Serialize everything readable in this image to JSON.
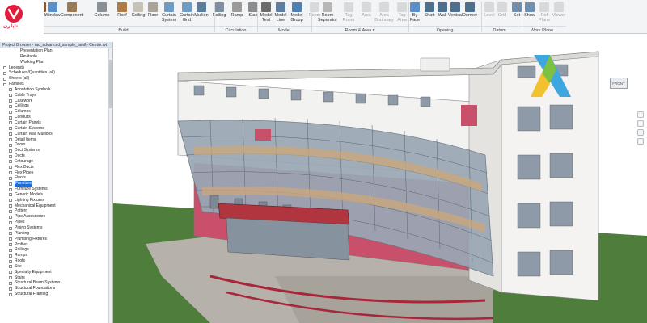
{
  "logo": {
    "text": "ﺗﺎﭘﻠﺮﻥ"
  },
  "ribbon": {
    "tools": [
      {
        "id": "door",
        "label": "Door",
        "enabled": true
      },
      {
        "id": "window",
        "label": "Window",
        "enabled": true
      },
      {
        "id": "component",
        "label": "Component",
        "enabled": true
      },
      {
        "id": "column",
        "label": "Column",
        "enabled": true
      },
      {
        "id": "roof",
        "label": "Roof",
        "enabled": true
      },
      {
        "id": "ceiling",
        "label": "Ceiling",
        "enabled": true
      },
      {
        "id": "floor",
        "label": "Floor",
        "enabled": true
      },
      {
        "id": "curtain-system",
        "label": "Curtain\nSystem",
        "enabled": true
      },
      {
        "id": "curtain-grid",
        "label": "Curtain\nGrid",
        "enabled": true
      },
      {
        "id": "mullion",
        "label": "Mullion",
        "enabled": true
      },
      {
        "id": "railing",
        "label": "Railing",
        "enabled": true
      },
      {
        "id": "ramp",
        "label": "Ramp",
        "enabled": true
      },
      {
        "id": "stair",
        "label": "Stair",
        "enabled": true
      },
      {
        "id": "model-text",
        "label": "Model\nText",
        "enabled": true
      },
      {
        "id": "model-line",
        "label": "Model\nLine",
        "enabled": true
      },
      {
        "id": "model-group",
        "label": "Model\nGroup",
        "enabled": true
      },
      {
        "id": "room",
        "label": "Room",
        "enabled": false
      },
      {
        "id": "room-separator",
        "label": "Room\nSeparator",
        "enabled": true
      },
      {
        "id": "tag-room",
        "label": "Tag\nRoom",
        "enabled": false
      },
      {
        "id": "area",
        "label": "Area",
        "enabled": false
      },
      {
        "id": "area-boundary",
        "label": "Area\nBoundary",
        "enabled": false
      },
      {
        "id": "tag-area",
        "label": "Tag\nArea",
        "enabled": false
      },
      {
        "id": "by-face",
        "label": "By\nFace",
        "enabled": true
      },
      {
        "id": "shaft",
        "label": "Shaft",
        "enabled": true
      },
      {
        "id": "wall",
        "label": "Wall",
        "enabled": true
      },
      {
        "id": "vertical",
        "label": "Vertical",
        "enabled": true
      },
      {
        "id": "dormer",
        "label": "Dormer",
        "enabled": true
      },
      {
        "id": "level",
        "label": "Level",
        "enabled": false
      },
      {
        "id": "grid",
        "label": "Grid",
        "enabled": false
      },
      {
        "id": "set",
        "label": "Set",
        "enabled": true
      },
      {
        "id": "show",
        "label": "Show",
        "enabled": true
      },
      {
        "id": "ref-plane",
        "label": "Ref\nPlane",
        "enabled": false
      },
      {
        "id": "viewer",
        "label": "Viewer",
        "enabled": false
      }
    ],
    "panels": [
      {
        "id": "build",
        "label": "Build"
      },
      {
        "id": "circulation",
        "label": "Circulation"
      },
      {
        "id": "model",
        "label": "Model"
      },
      {
        "id": "room-area",
        "label": "Room & Area ▾"
      },
      {
        "id": "opening",
        "label": "Opening"
      },
      {
        "id": "datum",
        "label": "Datum"
      },
      {
        "id": "work-plane",
        "label": "Work Plane"
      }
    ]
  },
  "browser": {
    "title": "Project Browser - rac_advanced_sample_family Centre.rvt",
    "items": [
      {
        "label": "Presentation Plan",
        "depth": 2,
        "expander": false
      },
      {
        "label": "Revitable",
        "depth": 2,
        "expander": false
      },
      {
        "label": "Working Plan",
        "depth": 2,
        "expander": false
      },
      {
        "label": "Legends",
        "depth": 0,
        "expander": true
      },
      {
        "label": "Schedules/Quantities (all)",
        "depth": 0,
        "expander": true
      },
      {
        "label": "Sheets (all)",
        "depth": 0,
        "expander": true
      },
      {
        "label": "Families",
        "depth": 0,
        "expander": true
      },
      {
        "label": "Annotation Symbols",
        "depth": 1,
        "expander": true
      },
      {
        "label": "Cable Trays",
        "depth": 1,
        "expander": true
      },
      {
        "label": "Casework",
        "depth": 1,
        "expander": true
      },
      {
        "label": "Ceilings",
        "depth": 1,
        "expander": true
      },
      {
        "label": "Columns",
        "depth": 1,
        "expander": true
      },
      {
        "label": "Conduits",
        "depth": 1,
        "expander": true
      },
      {
        "label": "Curtain Panels",
        "depth": 1,
        "expander": true
      },
      {
        "label": "Curtain Systems",
        "depth": 1,
        "expander": true
      },
      {
        "label": "Curtain Wall Mullions",
        "depth": 1,
        "expander": true
      },
      {
        "label": "Detail Items",
        "depth": 1,
        "expander": true
      },
      {
        "label": "Doors",
        "depth": 1,
        "expander": true
      },
      {
        "label": "Duct Systems",
        "depth": 1,
        "expander": true
      },
      {
        "label": "Ducts",
        "depth": 1,
        "expander": true
      },
      {
        "label": "Entourage",
        "depth": 1,
        "expander": true
      },
      {
        "label": "Flex Ducts",
        "depth": 1,
        "expander": true
      },
      {
        "label": "Flex Pipes",
        "depth": 1,
        "expander": true
      },
      {
        "label": "Floors",
        "depth": 1,
        "expander": true
      },
      {
        "label": "Furniture",
        "depth": 1,
        "expander": true,
        "selected": true
      },
      {
        "label": "Furniture Systems",
        "depth": 1,
        "expander": true
      },
      {
        "label": "Generic Models",
        "depth": 1,
        "expander": true
      },
      {
        "label": "Lighting Fixtures",
        "depth": 1,
        "expander": true
      },
      {
        "label": "Mechanical Equipment",
        "depth": 1,
        "expander": true
      },
      {
        "label": "Pattern",
        "depth": 1,
        "expander": true
      },
      {
        "label": "Pipe Accessories",
        "depth": 1,
        "expander": true
      },
      {
        "label": "Pipes",
        "depth": 1,
        "expander": true
      },
      {
        "label": "Piping Systems",
        "depth": 1,
        "expander": true
      },
      {
        "label": "Planting",
        "depth": 1,
        "expander": true
      },
      {
        "label": "Plumbing Fixtures",
        "depth": 1,
        "expander": true
      },
      {
        "label": "Profiles",
        "depth": 1,
        "expander": true
      },
      {
        "label": "Railings",
        "depth": 1,
        "expander": true
      },
      {
        "label": "Ramps",
        "depth": 1,
        "expander": true
      },
      {
        "label": "Roofs",
        "depth": 1,
        "expander": true
      },
      {
        "label": "Site",
        "depth": 1,
        "expander": true
      },
      {
        "label": "Specialty Equipment",
        "depth": 1,
        "expander": true
      },
      {
        "label": "Stairs",
        "depth": 1,
        "expander": true
      },
      {
        "label": "Structural Beam Systems",
        "depth": 1,
        "expander": true
      },
      {
        "label": "Structural Foundations",
        "depth": 1,
        "expander": true
      },
      {
        "label": "Structural Framing",
        "depth": 1,
        "expander": true
      }
    ]
  },
  "viewport": {
    "viewcube_label": "FRONT",
    "colors": {
      "wall_white": "#f2f2f0",
      "wall_red": "#c8506a",
      "glass": "#9aa7b4",
      "ground": "#4e7d3c",
      "paving": "#b6b2ab",
      "railing": "#a8263a",
      "sky": "#ffffff"
    },
    "sign_colors": [
      "#3fa7df",
      "#7cc142",
      "#f2c12e"
    ]
  }
}
